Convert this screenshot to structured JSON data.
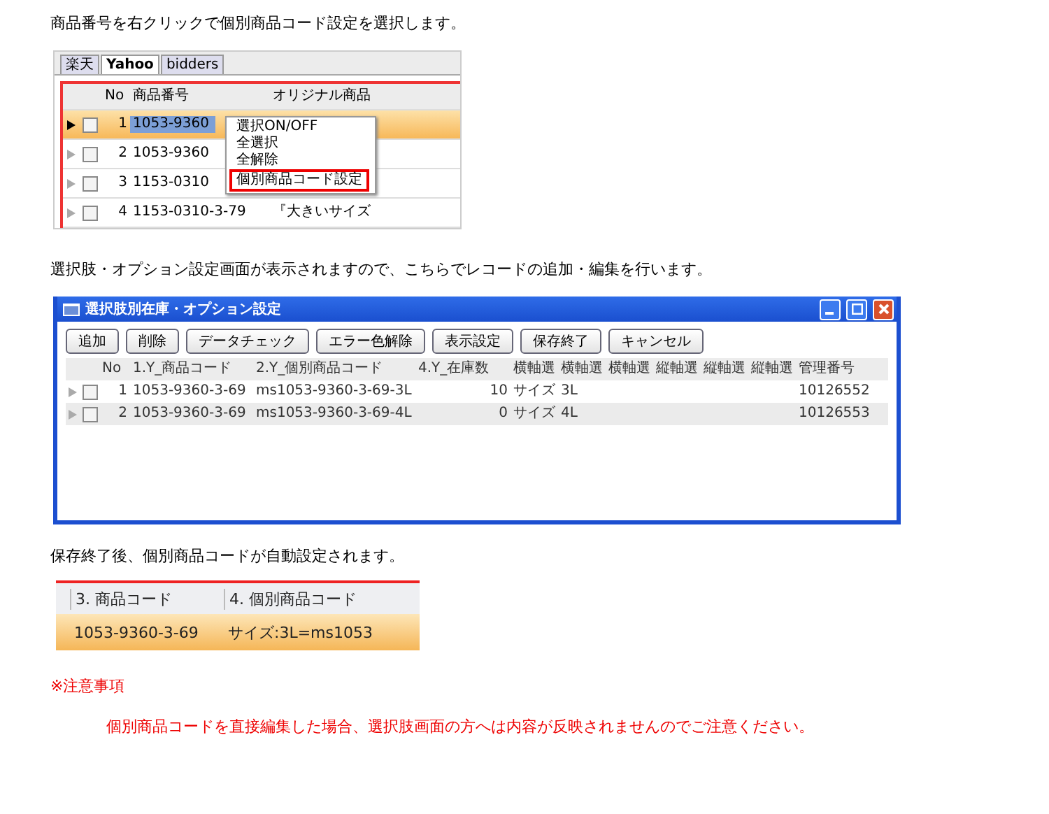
{
  "intro_1": "商品番号を右クリックで個別商品コード設定を選択します。",
  "grid_shot": {
    "tabs": [
      {
        "label": "楽天",
        "selected": false
      },
      {
        "label": "Yahoo",
        "selected": true
      },
      {
        "label": "bidders",
        "selected": false
      }
    ],
    "columns": [
      "No",
      "商品番号",
      "オリジナル商品"
    ],
    "rows": [
      {
        "no": "1",
        "code": "1053-9360",
        "selected": true,
        "checked": false
      },
      {
        "no": "2",
        "code": "1053-9360",
        "selected": false,
        "checked": false
      },
      {
        "no": "3",
        "code": "1153-0310",
        "selected": false,
        "checked": false
      },
      {
        "no": "4",
        "code": "1153-0310-3-79",
        "name": "『大きいサイズ",
        "selected": false,
        "checked": false
      }
    ],
    "context_menu": [
      {
        "label": "選択ON/OFF",
        "highlighted": false
      },
      {
        "label": "全選択",
        "highlighted": false
      },
      {
        "label": "全解除",
        "highlighted": false
      },
      {
        "label": "個別商品コード設定",
        "highlighted": true
      }
    ]
  },
  "intro_2": "選択肢・オプション設定画面が表示されますので、こちらでレコードの追加・編集を行います。",
  "option_window": {
    "title": "選択肢別在庫・オプション設定",
    "buttons": [
      "追加",
      "削除",
      "データチェック",
      "エラー色解除",
      "表示設定",
      "保存終了",
      "キャンセル"
    ],
    "columns": [
      "No",
      "1.Y_商品コード",
      "2.Y_個別商品コード",
      "4.Y_在庫数",
      "横軸選",
      "横軸選",
      "横軸選",
      "縦軸選",
      "縦軸選",
      "縦軸選",
      "管理番号"
    ],
    "rows": [
      {
        "checked": false,
        "cells": [
          "1",
          "1053-9360-3-69",
          "ms1053-9360-3-69-3L",
          "10",
          "サイズ",
          "3L",
          "",
          "",
          "",
          "",
          "10126552"
        ]
      },
      {
        "checked": false,
        "cells": [
          "2",
          "1053-9360-3-69",
          "ms1053-9360-3-69-4L",
          "0",
          "サイズ",
          "4L",
          "",
          "",
          "",
          "",
          "10126553"
        ]
      }
    ]
  },
  "intro_3": "保存終了後、個別商品コードが自動設定されます。",
  "result_shot": {
    "columns": [
      "3. 商品コード",
      "4. 個別商品コード"
    ],
    "row": [
      "1053-9360-3-69",
      "サイズ:3L=ms1053"
    ]
  },
  "notice_heading": "※注意事項",
  "notice_text": "個別商品コードを直接編集した場合、選択肢画面の方へは内容が反映されませんのでご注意ください。"
}
